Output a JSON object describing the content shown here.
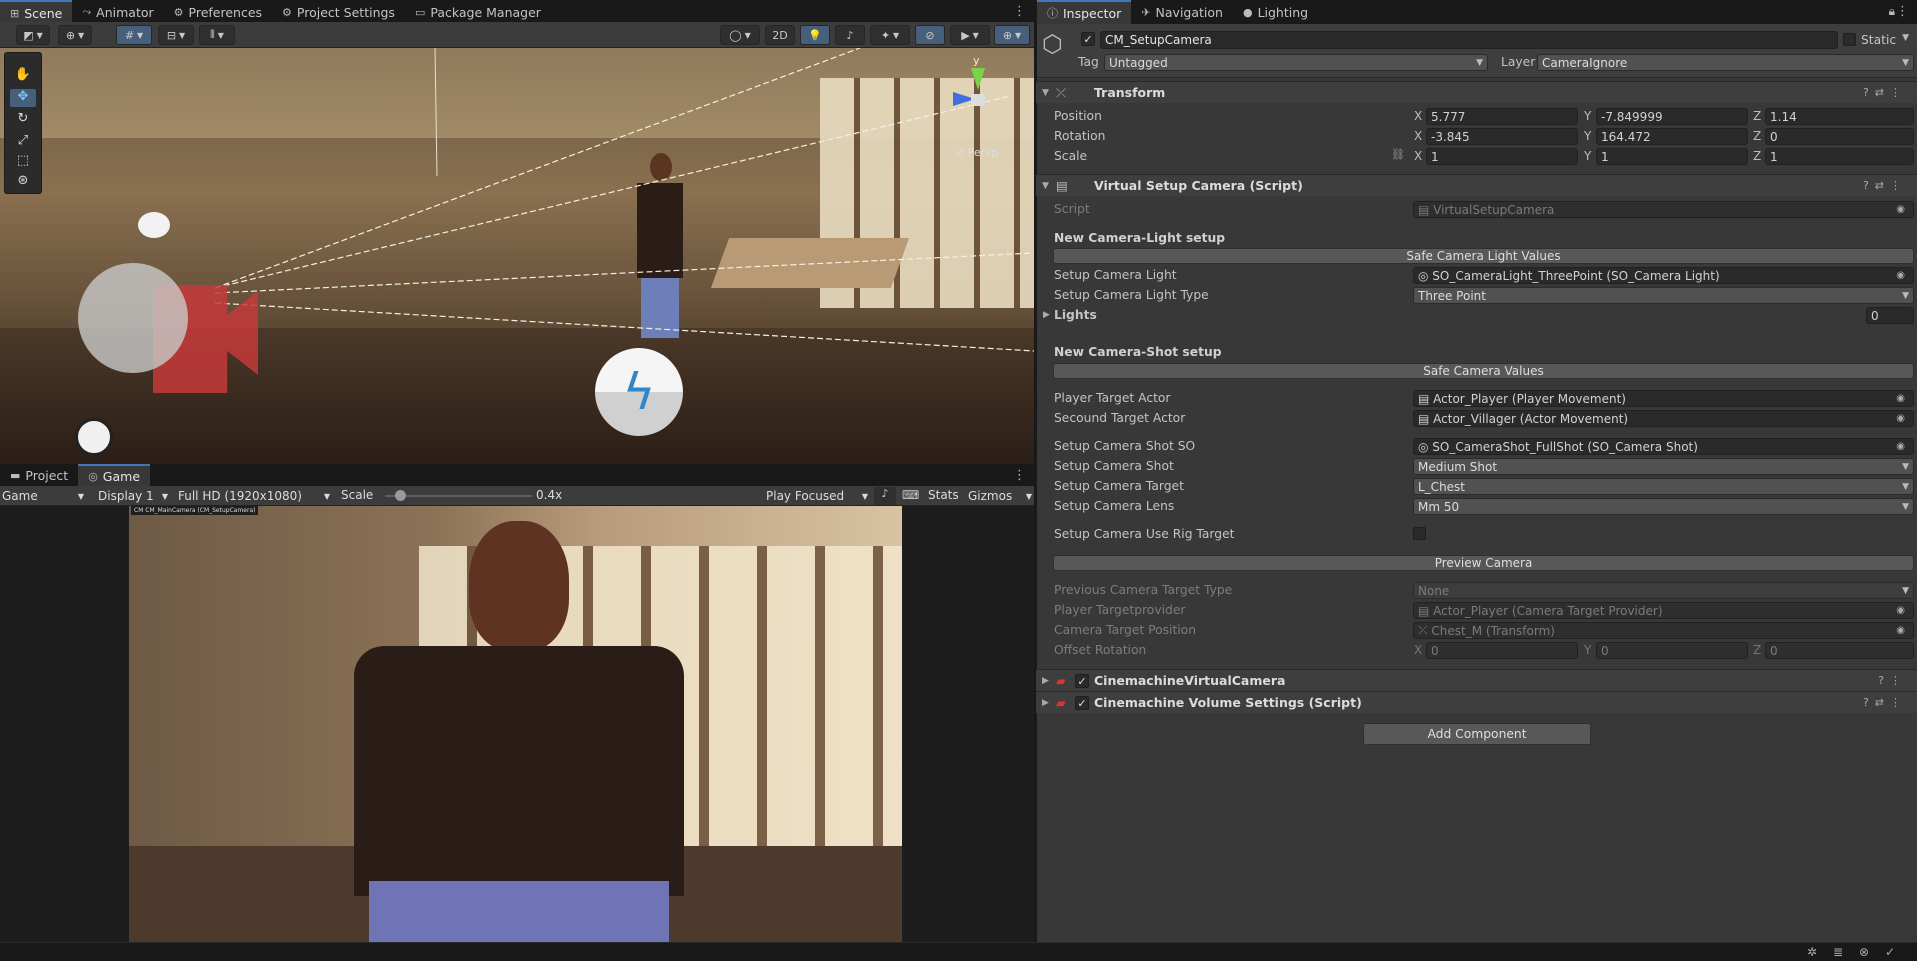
{
  "scene_tabs": [
    {
      "label": "Scene",
      "icon": "grid-icon"
    },
    {
      "label": "Animator",
      "icon": "animator-icon"
    },
    {
      "label": "Preferences",
      "icon": "gear-icon"
    },
    {
      "label": "Project Settings",
      "icon": "gear-icon"
    },
    {
      "label": "Package Manager",
      "icon": "package-icon"
    }
  ],
  "scene_toolbar": {
    "mode_2d": "2D",
    "persp_label": "< Persp",
    "gizmo_axis": "y"
  },
  "game_tabs": [
    {
      "label": "Project"
    },
    {
      "label": "Game"
    }
  ],
  "game_toolbar": {
    "view": "Game",
    "display": "Display 1",
    "resolution": "Full HD (1920x1080)",
    "scale_label": "Scale",
    "scale_value": "0.4x",
    "scale_fraction": 0.1,
    "play_mode": "Play Focused",
    "stats": "Stats",
    "gizmos": "Gizmos"
  },
  "game_overlay_label": "CM CM_MainCamera (CM_SetupCamera)",
  "inspector_tabs": [
    {
      "label": "Inspector"
    },
    {
      "label": "Navigation"
    },
    {
      "label": "Lighting"
    }
  ],
  "object": {
    "name": "CM_SetupCamera",
    "static_label": "Static",
    "tag_label": "Tag",
    "tag": "Untagged",
    "layer_label": "Layer",
    "layer": "CameraIgnore"
  },
  "transform": {
    "title": "Transform",
    "position": {
      "label": "Position",
      "x": "5.777",
      "y": "-7.849999",
      "z": "1.14"
    },
    "rotation": {
      "label": "Rotation",
      "x": "-3.845",
      "y": "164.472",
      "z": "0"
    },
    "scale": {
      "label": "Scale",
      "x": "1",
      "y": "1",
      "z": "1"
    }
  },
  "script_comp": {
    "title": "Virtual Setup Camera (Script)",
    "script_label": "Script",
    "script_value": "VirtualSetupCamera",
    "light_section": "New Camera-Light setup",
    "safe_light_btn": "Safe Camera Light Values",
    "setup_light_label": "Setup Camera Light",
    "setup_light_value": "SO_CameraLight_ThreePoint (SO_Camera Light)",
    "light_type_label": "Setup Camera Light Type",
    "light_type_value": "Three Point",
    "lights_label": "Lights",
    "lights_value": "0",
    "shot_section": "New Camera-Shot setup",
    "safe_shot_btn": "Safe Camera Values",
    "player_label": "Player Target Actor",
    "player_value": "Actor_Player (Player Movement)",
    "second_label": "Secound Target Actor",
    "second_value": "Actor_Villager (Actor Movement)",
    "shot_so_label": "Setup Camera Shot SO",
    "shot_so_value": "SO_CameraShot_FullShot (SO_Camera Shot)",
    "shot_label": "Setup Camera Shot",
    "shot_value": "Medium Shot",
    "target_label": "Setup Camera Target",
    "target_value": "L_Chest",
    "lens_label": "Setup Camera Lens",
    "lens_value": "Mm 50",
    "rig_label": "Setup Camera Use Rig Target",
    "preview_btn": "Preview Camera",
    "prev_type_label": "Previous Camera Target Type",
    "prev_type_value": "None",
    "provider_label": "Player Targetprovider",
    "provider_value": "Actor_Player (Camera Target Provider)",
    "target_pos_label": "Camera Target Position",
    "target_pos_value": "Chest_M (Transform)",
    "offset_label": "Offset Rotation",
    "offset_x": "0",
    "offset_y": "0",
    "offset_z": "0"
  },
  "components": [
    {
      "title": "CinemachineVirtualCamera"
    },
    {
      "title": "Cinemachine Volume Settings (Script)"
    }
  ],
  "add_component": "Add Component",
  "axes": {
    "x": "X",
    "y": "Y",
    "z": "Z"
  },
  "colors": {
    "accent": "#3a79bb",
    "panel": "#383838",
    "bg": "#191919"
  }
}
